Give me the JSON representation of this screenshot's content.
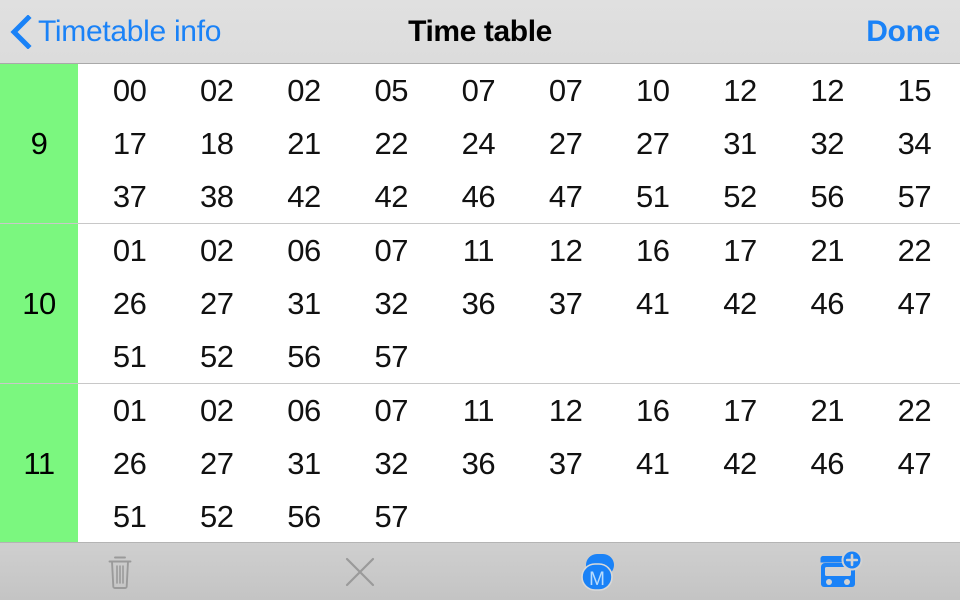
{
  "navbar": {
    "back_icon": "chevron-left-icon",
    "back_label": "Timetable info",
    "title": "Time table",
    "done_label": "Done",
    "tint_color": "#1a82f7"
  },
  "timetable": {
    "hour_cell_color": "#7bf77f",
    "columns": 10,
    "rows": [
      {
        "hour": "9",
        "minutes": [
          "00",
          "02",
          "02",
          "05",
          "07",
          "07",
          "10",
          "12",
          "12",
          "15",
          "17",
          "18",
          "21",
          "22",
          "24",
          "27",
          "27",
          "31",
          "32",
          "34",
          "37",
          "38",
          "42",
          "42",
          "46",
          "47",
          "51",
          "52",
          "56",
          "57"
        ]
      },
      {
        "hour": "10",
        "minutes": [
          "01",
          "02",
          "06",
          "07",
          "11",
          "12",
          "16",
          "17",
          "21",
          "22",
          "26",
          "27",
          "31",
          "32",
          "36",
          "37",
          "41",
          "42",
          "46",
          "47",
          "51",
          "52",
          "56",
          "57",
          "",
          "",
          "",
          "",
          "",
          ""
        ]
      },
      {
        "hour": "11",
        "minutes": [
          "01",
          "02",
          "06",
          "07",
          "11",
          "12",
          "16",
          "17",
          "21",
          "22",
          "26",
          "27",
          "31",
          "32",
          "36",
          "37",
          "41",
          "42",
          "46",
          "47",
          "51",
          "52",
          "56",
          "57",
          "",
          "",
          "",
          "",
          "",
          ""
        ]
      }
    ]
  },
  "toolbar": {
    "items": [
      {
        "name": "delete-button",
        "icon": "trash-icon",
        "state": "disabled",
        "color": "#9a9a9a"
      },
      {
        "name": "clear-button",
        "icon": "close-x-icon",
        "state": "disabled",
        "color": "#9a9a9a"
      },
      {
        "name": "map-button",
        "icon": "map-marker-m-icon",
        "state": "enabled",
        "color": "#1a82f7",
        "badge_letter": "M"
      },
      {
        "name": "add-transport-button",
        "icon": "bus-plus-icon",
        "state": "enabled",
        "color": "#1a82f7"
      }
    ]
  }
}
